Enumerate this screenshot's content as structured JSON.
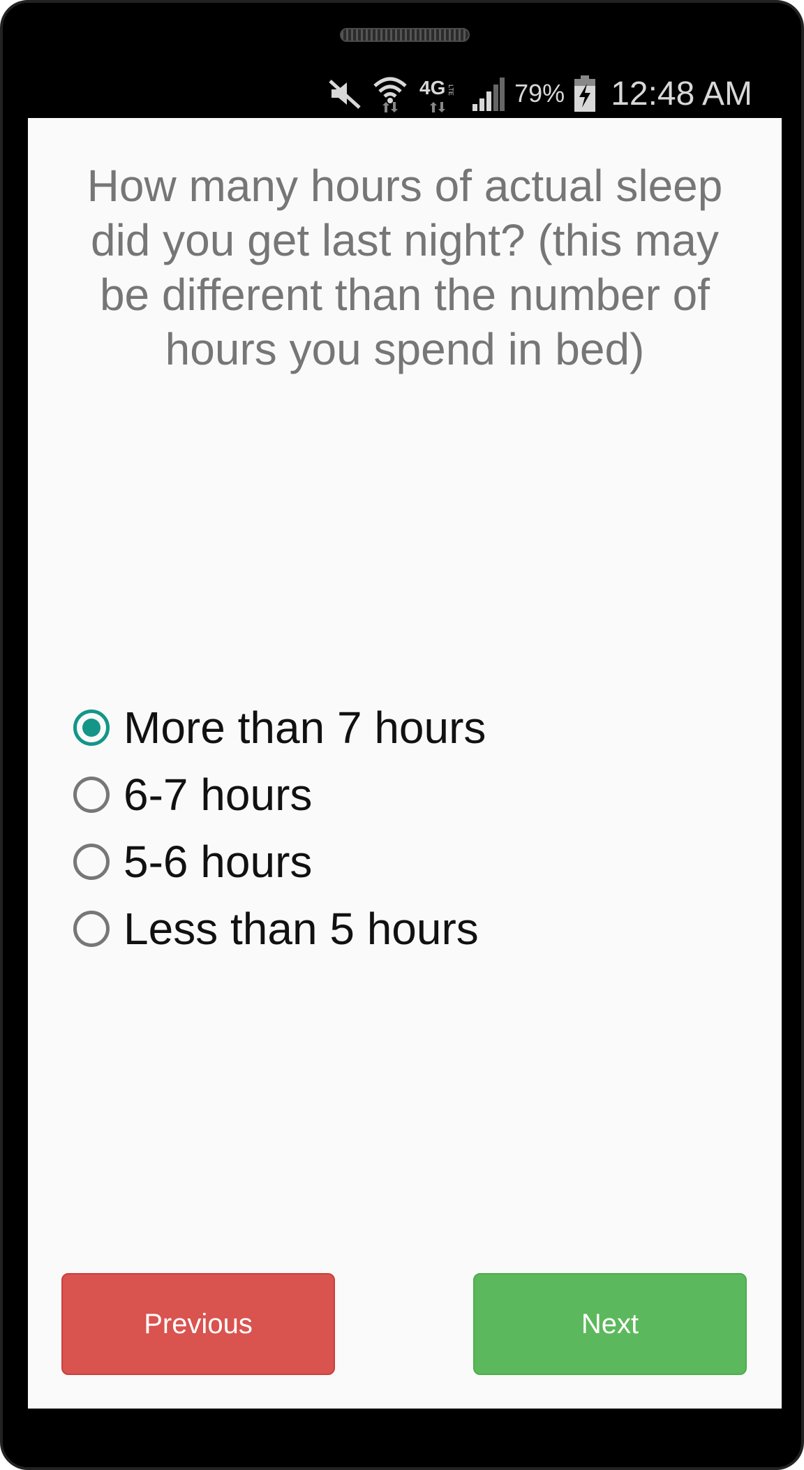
{
  "status_bar": {
    "icons": [
      "mute-icon",
      "wifi-icon",
      "4g-lte-icon",
      "signal-icon",
      "battery-charging-icon"
    ],
    "network_label": "4G",
    "battery_percent": "79%",
    "time": "12:48 AM"
  },
  "survey": {
    "question": "How many hours of actual sleep did you get last night? (this may be different than the number of hours you spend in bed)",
    "options": [
      {
        "label": "More than 7 hours",
        "selected": true
      },
      {
        "label": "6-7 hours",
        "selected": false
      },
      {
        "label": "5-6 hours",
        "selected": false
      },
      {
        "label": "Less than 5 hours",
        "selected": false
      }
    ],
    "accent_color": "#139688"
  },
  "navigation": {
    "previous_label": "Previous",
    "next_label": "Next",
    "previous_color": "#d9534f",
    "next_color": "#5cb85c"
  }
}
